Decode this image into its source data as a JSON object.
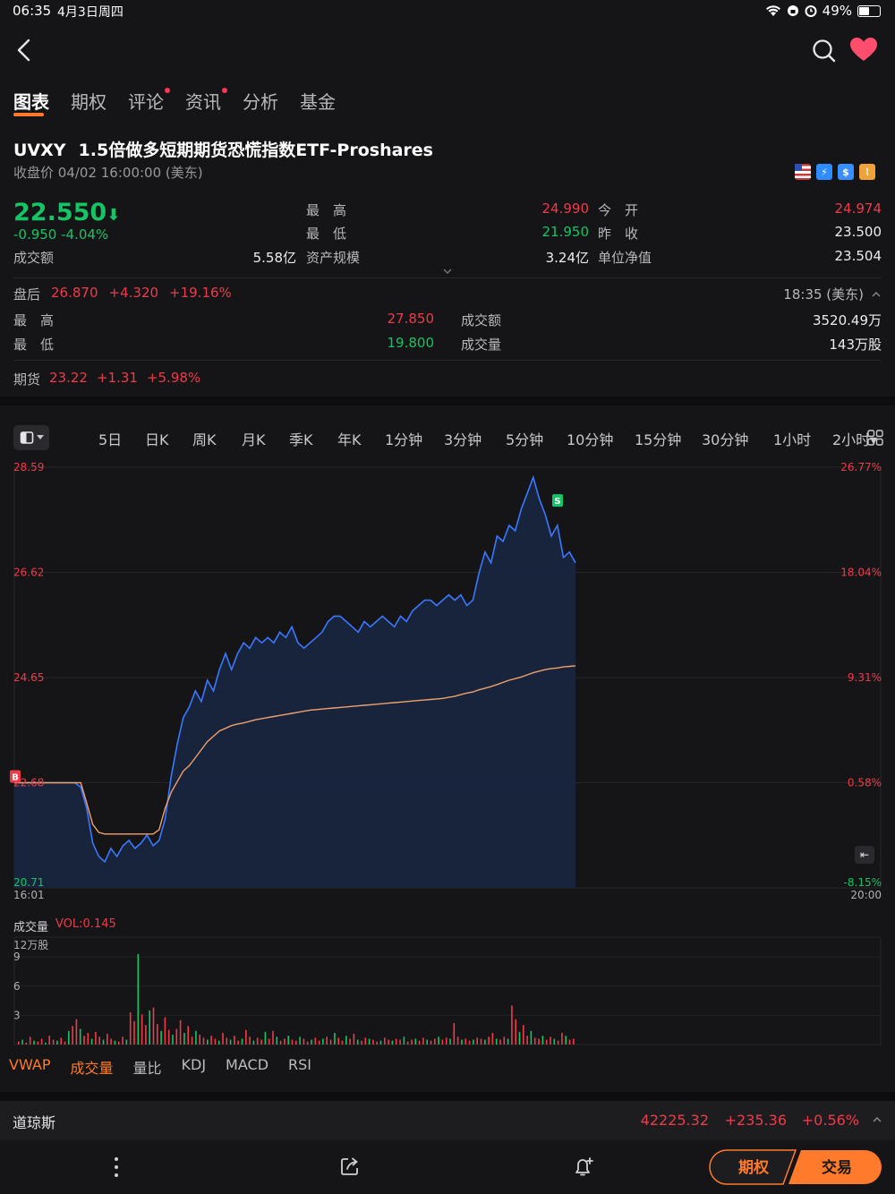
{
  "status_bar": {
    "time": "06:35",
    "date": "4月3日周四",
    "battery": "49%"
  },
  "tabs": [
    {
      "label": "图表",
      "active": true,
      "dot": false
    },
    {
      "label": "期权",
      "active": false,
      "dot": false
    },
    {
      "label": "评论",
      "active": false,
      "dot": true
    },
    {
      "label": "资讯",
      "active": false,
      "dot": true
    },
    {
      "label": "分析",
      "active": false,
      "dot": false
    },
    {
      "label": "基金",
      "active": false,
      "dot": false
    }
  ],
  "stock": {
    "ticker": "UVXY",
    "name": "1.5倍做多短期期货恐慌指数ETF-Proshares",
    "close_time": "收盘价 04/02 16:00:00 (美东)",
    "price": "22.550",
    "change": "-0.950  -4.04%"
  },
  "quote": {
    "turnover_label": "成交额",
    "turnover": "5.58亿",
    "high_label": "最　高",
    "high": "24.990",
    "low_label": "最　低",
    "low": "21.950",
    "aum_label": "资产规模",
    "aum": "3.24亿",
    "open_label": "今　开",
    "open": "24.974",
    "prev_close_label": "昨　收",
    "prev_close": "23.500",
    "nav_label": "单位净值",
    "nav": "23.504"
  },
  "after_hours": {
    "label": "盘后",
    "price": "26.870",
    "change": "+4.320",
    "percent": "+19.16%",
    "time": "18:35 (美东)",
    "high_label": "最　高",
    "high": "27.850",
    "low_label": "最　低",
    "low": "19.800",
    "amount_label": "成交额",
    "amount": "3520.49万",
    "volume_label": "成交量",
    "volume": "143万股"
  },
  "futures": {
    "label": "期货",
    "price": "23.22",
    "change": "+1.31",
    "percent": "+5.98%"
  },
  "periods": [
    "5日",
    "日K",
    "周K",
    "月K",
    "季K",
    "年K",
    "1分钟",
    "3分钟",
    "5分钟",
    "10分钟",
    "15分钟",
    "30分钟",
    "1小时",
    "2小时▾"
  ],
  "chart_data": {
    "type": "line",
    "y_left_ticks": [
      "28.59",
      "26.62",
      "24.65",
      "22.68",
      "20.71"
    ],
    "y_right_ticks": [
      "26.77%",
      "18.04%",
      "9.31%",
      "0.58%",
      "-8.15%"
    ],
    "x_ticks": [
      "16:01",
      "20:00"
    ],
    "ylim": [
      20.71,
      28.59
    ],
    "markers": {
      "buy": "B",
      "sell": "S"
    },
    "price_series": [
      22.68,
      22.68,
      22.68,
      22.68,
      22.68,
      22.68,
      22.68,
      22.68,
      22.68,
      22.68,
      22.68,
      22.6,
      22.2,
      21.55,
      21.3,
      21.2,
      21.45,
      21.3,
      21.5,
      21.6,
      21.45,
      21.55,
      21.7,
      21.5,
      21.6,
      22.0,
      22.8,
      23.4,
      23.9,
      24.1,
      24.4,
      24.2,
      24.6,
      24.4,
      24.8,
      25.1,
      24.8,
      25.1,
      25.3,
      25.2,
      25.4,
      25.3,
      25.4,
      25.3,
      25.5,
      25.4,
      25.6,
      25.3,
      25.2,
      25.3,
      25.4,
      25.5,
      25.7,
      25.8,
      25.8,
      25.7,
      25.6,
      25.5,
      25.7,
      25.6,
      25.7,
      25.8,
      25.7,
      25.6,
      25.8,
      25.7,
      25.9,
      26.0,
      26.1,
      26.1,
      26.0,
      26.1,
      26.2,
      26.1,
      26.2,
      26.0,
      26.1,
      26.6,
      27.0,
      26.8,
      27.3,
      27.2,
      27.5,
      27.4,
      27.8,
      28.1,
      28.4,
      28.0,
      27.7,
      27.3,
      27.5,
      26.9,
      27.0,
      26.8
    ],
    "vwap_series": [
      22.68,
      22.68,
      22.68,
      22.68,
      22.68,
      22.68,
      22.68,
      22.68,
      22.68,
      22.68,
      22.68,
      22.68,
      22.3,
      21.9,
      21.75,
      21.72,
      21.72,
      21.72,
      21.72,
      21.72,
      21.72,
      21.72,
      21.72,
      21.72,
      21.8,
      22.2,
      22.5,
      22.7,
      22.9,
      23.0,
      23.15,
      23.3,
      23.45,
      23.55,
      23.65,
      23.7,
      23.75,
      23.78,
      23.8,
      23.83,
      23.86,
      23.88,
      23.9,
      23.92,
      23.94,
      23.96,
      23.98,
      24.0,
      24.02,
      24.04,
      24.05,
      24.06,
      24.07,
      24.08,
      24.09,
      24.1,
      24.11,
      24.12,
      24.13,
      24.14,
      24.15,
      24.16,
      24.17,
      24.18,
      24.19,
      24.2,
      24.21,
      24.22,
      24.23,
      24.24,
      24.25,
      24.26,
      24.28,
      24.3,
      24.33,
      24.36,
      24.38,
      24.42,
      24.45,
      24.48,
      24.52,
      24.56,
      24.6,
      24.63,
      24.66,
      24.7,
      24.74,
      24.77,
      24.8,
      24.82,
      24.83,
      24.85,
      24.86,
      24.87
    ]
  },
  "volume": {
    "label": "成交量",
    "vol_text": "VOL:0.145",
    "unit": "12万股",
    "y_ticks": [
      "9",
      "6",
      "3"
    ],
    "bars": [
      0.3,
      0.5,
      0.2,
      0.8,
      0.4,
      0.3,
      0.6,
      0.2,
      0.9,
      0.5,
      0.4,
      0.7,
      0.3,
      1.4,
      1.9,
      2.6,
      1.6,
      0.9,
      1.2,
      0.6,
      1.3,
      0.8,
      0.5,
      1.1,
      0.6,
      0.4,
      0.3,
      0.8,
      0.5,
      3.3,
      2.4,
      9.3,
      3.1,
      2.0,
      3.5,
      3.8,
      2.1,
      1.4,
      2.8,
      1.5,
      1.0,
      1.6,
      2.5,
      1.2,
      1.9,
      0.8,
      1.4,
      1.0,
      0.7,
      0.5,
      0.9,
      0.6,
      0.4,
      1.2,
      0.7,
      0.5,
      0.9,
      0.4,
      0.6,
      1.5,
      0.8,
      0.4,
      0.7,
      0.5,
      1.3,
      0.6,
      1.4,
      0.8,
      0.4,
      0.6,
      0.9,
      0.5,
      0.4,
      0.8,
      0.6,
      0.3,
      0.5,
      0.7,
      0.4,
      0.6,
      0.8,
      0.5,
      1.2,
      0.7,
      0.4,
      0.9,
      0.6,
      1.1,
      0.5,
      0.4,
      0.7,
      0.6,
      0.5,
      0.3,
      0.4,
      0.7,
      0.5,
      0.4,
      0.6,
      0.5,
      0.8,
      0.3,
      0.5,
      0.6,
      0.4,
      0.7,
      0.5,
      0.4,
      0.6,
      0.8,
      0.5,
      0.7,
      0.6,
      2.2,
      0.8,
      0.5,
      0.6,
      0.4,
      0.5,
      0.7,
      0.6,
      0.5,
      0.8,
      1.2,
      0.6,
      0.5,
      0.8,
      0.6,
      4.0,
      2.6,
      1.3,
      2.0,
      0.9,
      1.4,
      0.7,
      0.6,
      0.9,
      0.5,
      0.8,
      0.6,
      0.4,
      1.2,
      0.9,
      0.5,
      0.6
    ]
  },
  "indicators": [
    {
      "label": "VWAP",
      "orange": true
    },
    {
      "label": "成交量",
      "orange": true
    },
    {
      "label": "量比",
      "orange": false
    },
    {
      "label": "KDJ",
      "orange": false
    },
    {
      "label": "MACD",
      "orange": false
    },
    {
      "label": "RSI",
      "orange": false
    }
  ],
  "dow": {
    "name": "道琼斯",
    "price": "42225.32",
    "change": "+235.36",
    "percent": "+0.56%"
  },
  "bottom": {
    "options_btn": "期权",
    "trade_btn": "交易"
  },
  "colors": {
    "up": "#ee3b4a",
    "down": "#14c465",
    "accent": "#ff7a2a",
    "price_line": "#3a78ff",
    "vwap_line": "#f0a16b"
  }
}
